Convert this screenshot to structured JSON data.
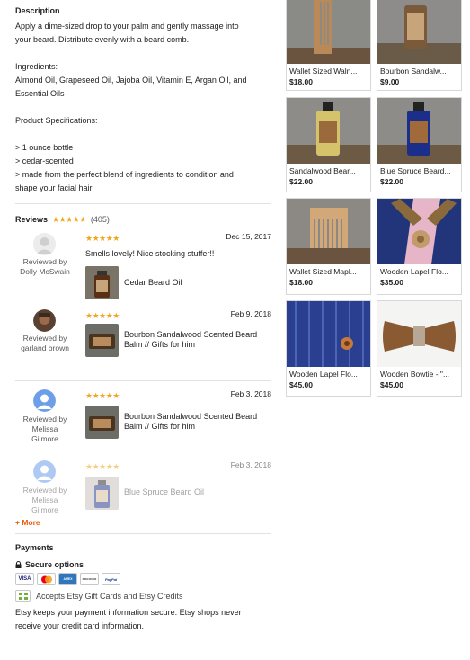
{
  "description": {
    "heading": "Description",
    "line1": "Apply a dime-sized drop to your palm and gently massage into",
    "line2": "your beard. Distribute evenly with a beard comb.",
    "ingredients_label": "Ingredients:",
    "ingredients_line1": "Almond Oil, Grapeseed Oil, Jajoba Oil, Vitamin E, Argan Oil, and",
    "ingredients_line2": "Essential Oils",
    "specs_label": "Product Specifications:",
    "spec1": "> 1 ounce bottle",
    "spec2": "> cedar-scented",
    "spec3_line1": "> made from the perfect blend of ingredients to condition and",
    "spec3_line2": "shape your facial hair"
  },
  "reviews": {
    "title": "Reviews",
    "stars": "★★★★★",
    "count": "(405)",
    "items": [
      {
        "reviewer_prefix": "Reviewed by",
        "reviewer": "Dolly McSwain",
        "stars": "★★★★★",
        "date": "Dec 15, 2017",
        "text": "Smells lovely! Nice stocking stuffer!!",
        "product": "Cedar Beard Oil"
      },
      {
        "reviewer_prefix": "Reviewed by",
        "reviewer": "garland brown",
        "stars": "★★★★★",
        "date": "Feb 9, 2018",
        "text": "",
        "product": "Bourbon Sandalwood Scented Beard Balm // Gifts for him"
      },
      {
        "reviewer_prefix": "Reviewed by",
        "reviewer": "Melissa Gilmore",
        "stars": "★★★★★",
        "date": "Feb 3, 2018",
        "text": "",
        "product": "Bourbon Sandalwood Scented Beard Balm // Gifts for him"
      },
      {
        "reviewer_prefix": "Reviewed by",
        "reviewer": "Melissa Gilmore",
        "stars": "★★★★★",
        "date": "Feb 3, 2018",
        "text": "",
        "product": "Blue Spruce Beard Oil"
      }
    ],
    "more": "+ More"
  },
  "payments": {
    "title": "Payments",
    "secure": "Secure options",
    "cards": [
      "VISA",
      "MC",
      "AMEX",
      "DISCOVER",
      "PayPal"
    ],
    "gift": "Accepts Etsy Gift Cards and Etsy Credits",
    "note_line1": "Etsy keeps your payment information secure. Etsy shops never",
    "note_line2": "receive your credit card information."
  },
  "related": [
    {
      "name": "Wallet Sized Waln...",
      "price": "$18.00",
      "icon": "wooden-comb"
    },
    {
      "name": "Bourbon Sandalw...",
      "price": "$9.00",
      "icon": "balm-tin"
    },
    {
      "name": "Sandalwood Bear...",
      "price": "$22.00",
      "icon": "clear-oil-bottle"
    },
    {
      "name": "Blue Spruce Beard...",
      "price": "$22.00",
      "icon": "blue-oil-bottle"
    },
    {
      "name": "Wallet Sized Mapl...",
      "price": "$18.00",
      "icon": "wooden-comb"
    },
    {
      "name": "Wooden Lapel Flo...",
      "price": "$35.00",
      "icon": "lapel-flower"
    },
    {
      "name": "Wooden Lapel Flo...",
      "price": "$45.00",
      "icon": "lapel-flower"
    },
    {
      "name": "Wooden Bowtie - \"...",
      "price": "$45.00",
      "icon": "wooden-bowtie"
    }
  ],
  "colors": {
    "star": "#f1a61f",
    "more": "#e85d0c",
    "divider": "#e1e3df"
  }
}
